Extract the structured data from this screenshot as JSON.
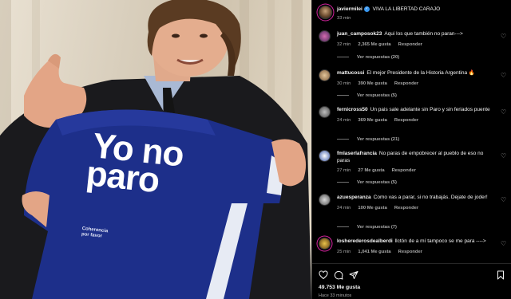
{
  "post": {
    "author": "javiermilei",
    "caption": "VIVA LA LIBERTAD CARAJO",
    "time": "33 min",
    "likes": "49.753 Me gusta",
    "ago": "Hace 33 minutos"
  },
  "photo": {
    "shirt_line1": "Yo no",
    "shirt_line2": "paro",
    "shirt_small1": "Coherencia",
    "shirt_small2": "por favor"
  },
  "comments": [
    {
      "user": "juan_camposok23",
      "text": "Aqui los que también no paran--->",
      "time": "32 min",
      "likes": "2,365 Me gusta",
      "reply": "Responder",
      "replies": "Ver respuestas (20)"
    },
    {
      "user": "mattucossi",
      "text": "El mejor Presidente de la Historia Argentina 🔥",
      "time": "30 min",
      "likes": "390 Me gusta",
      "reply": "Responder",
      "replies": "Ver respuestas (5)"
    },
    {
      "user": "fernicross50",
      "text": "Un pais sale adelante sin Paro y sin feriados puente",
      "time": "24 min",
      "likes": "369 Me gusta",
      "reply": "Responder",
      "replies": "Ver respuestas (21)"
    },
    {
      "user": "fmlaserlafrancia",
      "text": "No paras de empobrecer al pueblo de eso no paras",
      "time": "27 min",
      "likes": "27 Me gusta",
      "reply": "Responder",
      "replies": "Ver respuestas (5)"
    },
    {
      "user": "azuesperanza",
      "text": "Como vas a parar, si no trabajás. Dejate de joder!",
      "time": "24 min",
      "likes": "100 Me gusta",
      "reply": "Responder",
      "replies": "Ver respuestas (7)"
    },
    {
      "user": "losherederosdealberdi",
      "text": "llctón de a mí tampoco se me para ---->",
      "time": "25 min",
      "likes": "1,041 Me gusta",
      "reply": "Responder",
      "replies": ""
    }
  ],
  "icons": {
    "heart": "heart-icon",
    "comment": "comment-icon",
    "share": "share-icon",
    "save": "bookmark-icon"
  },
  "colors": {
    "background": "#000000",
    "muted": "#a8a8a8",
    "shirt": "#1d2f8a"
  }
}
